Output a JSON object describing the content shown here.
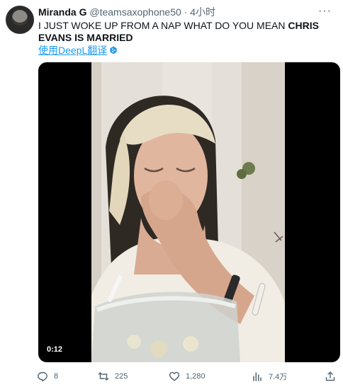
{
  "tweet": {
    "author_name": "Miranda G",
    "handle": "@teamsaxophone50",
    "separator": "·",
    "time_ago": "4小时",
    "text_normal": "I JUST WOKE UP FROM A NAP WHAT DO YOU MEAN ",
    "text_bold": "CHRIS EVANS IS MARRIED",
    "translate_label": "使用DeepL翻译",
    "more_label": "···"
  },
  "video": {
    "timestamp": "0:12"
  },
  "actions": {
    "replies": "8",
    "retweets": "225",
    "likes": "1,280",
    "views": "7.4万"
  },
  "colors": {
    "link_blue": "#1d9bf0",
    "muted_gray": "#536471",
    "text_dark": "#0f1419"
  }
}
